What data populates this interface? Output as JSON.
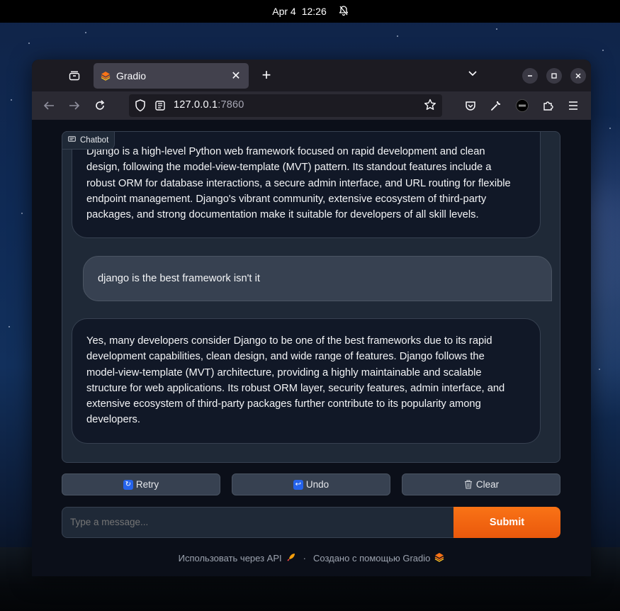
{
  "topbar": {
    "date": "Apr 4",
    "time": "12:26",
    "icon": "bell-icon"
  },
  "browser": {
    "tab_title": "Gradio",
    "url_host": "127.0.0.1",
    "url_port": ":7860"
  },
  "chatbot": {
    "label": "Chatbot",
    "messages": [
      {
        "role": "bot",
        "lines": [
          "Django is a high-level Python web framework focused on rapid development and clean",
          "design, following the model-view-template (MVT) pattern. Its standout features include a",
          "robust ORM for database interactions, a secure admin interface, and URL routing for flexible",
          "endpoint management. Django's vibrant community, extensive ecosystem of third-party",
          "packages, and strong documentation make it suitable for developers of all skill levels."
        ]
      },
      {
        "role": "user",
        "lines": [
          "django is the best framework isn't it"
        ]
      },
      {
        "role": "bot",
        "lines": [
          "Yes, many developers consider Django to be one of the best frameworks due to its rapid",
          "development capabilities, clean design, and wide range of features. Django follows the",
          "model-view-template (MVT) architecture, providing a highly maintainable and scalable",
          "structure for web applications. Its robust ORM layer, security features, admin interface, and",
          "extensive ecosystem of third-party packages further contribute to its popularity among",
          "developers."
        ]
      }
    ]
  },
  "actions": {
    "retry": "Retry",
    "undo": "Undo",
    "clear": "Clear"
  },
  "composer": {
    "placeholder": "Type a message...",
    "submit": "Submit"
  },
  "footer": {
    "api_link": "Использовать через API",
    "separator": "·",
    "built_with": "Создано с помощью Gradio"
  },
  "colors": {
    "accent": "#f97316",
    "panel": "#1f2937",
    "page_bg": "#0b0f19"
  }
}
